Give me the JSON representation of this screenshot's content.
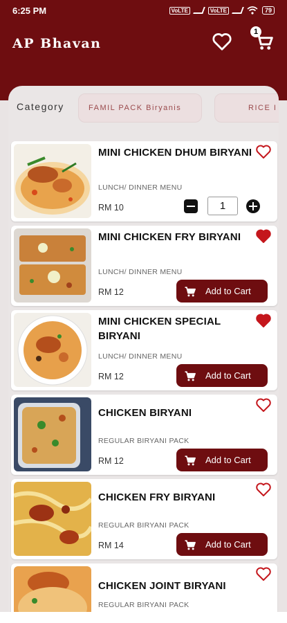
{
  "status_bar": {
    "time": "6:25 PM",
    "battery": "79"
  },
  "header": {
    "title": "AP Bhavan",
    "cart_count": "1"
  },
  "category": {
    "label": "Category",
    "chips": [
      "FAMIL PACK Biryanis",
      "RICE I"
    ]
  },
  "items": [
    {
      "name": "MINI CHICKEN DHUM BIRYANI",
      "menu": "LUNCH/ DINNER MENU",
      "price": "RM 10",
      "favorited": false,
      "quantity": "1",
      "image": "chicken-dhum-biryani"
    },
    {
      "name": "MINI CHICKEN FRY BIRYANI",
      "menu": "LUNCH/ DINNER MENU",
      "price": "RM 12",
      "favorited": true,
      "action": "Add to Cart",
      "image": "chicken-fry-biryani"
    },
    {
      "name": "MINI CHICKEN SPECIAL BIRYANI",
      "menu": "LUNCH/ DINNER MENU",
      "price": "RM 12",
      "favorited": true,
      "action": "Add to Cart",
      "image": "chicken-special-biryani"
    },
    {
      "name": "CHICKEN BIRYANI",
      "menu": "REGULAR BIRYANI PACK",
      "price": "RM 12",
      "favorited": false,
      "action": "Add to Cart",
      "image": "chicken-biryani"
    },
    {
      "name": "CHICKEN FRY BIRYANI",
      "menu": "REGULAR BIRYANI PACK",
      "price": "RM 14",
      "favorited": false,
      "action": "Add to Cart",
      "image": "chicken-fry-biryani-2"
    },
    {
      "name": "CHICKEN JOINT BIRYANI",
      "menu": "REGULAR BIRYANI PACK",
      "price": "",
      "favorited": false,
      "image": "chicken-joint-biryani"
    }
  ],
  "colors": {
    "brand": "#6e0d10",
    "accent_heart": "#c4161c",
    "background": "#eae6e6"
  }
}
